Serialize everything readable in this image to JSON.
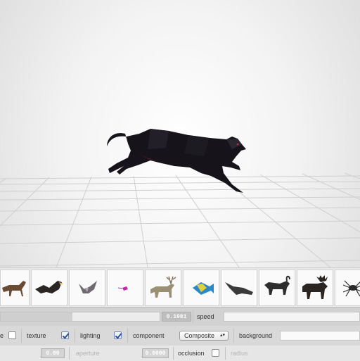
{
  "viewport": {
    "animal_name": "panther",
    "grid_color": "#cfcfcf",
    "model_color": "#16141a"
  },
  "thumbnails": [
    {
      "name": "horse",
      "icon": "horse-icon"
    },
    {
      "name": "eagle",
      "icon": "eagle-icon"
    },
    {
      "name": "owl",
      "icon": "owl-icon"
    },
    {
      "name": "hummingbird",
      "icon": "hummingbird-icon"
    },
    {
      "name": "stag",
      "icon": "stag-icon"
    },
    {
      "name": "fish",
      "icon": "fish-icon"
    },
    {
      "name": "crocodile",
      "icon": "crocodile-icon"
    },
    {
      "name": "goat",
      "icon": "goat-icon"
    },
    {
      "name": "moose",
      "icon": "moose-icon"
    },
    {
      "name": "spider",
      "icon": "spider-icon"
    }
  ],
  "controls": {
    "speed": {
      "value": "0.1981",
      "label": "speed",
      "fraction": 0.45
    },
    "row2": {
      "cut_label": "e",
      "wireframe_checked": false,
      "texture_label": "texture",
      "texture_checked": true,
      "lighting_label": "lighting",
      "lighting_checked": true,
      "component_label": "component",
      "component_value": "Composite",
      "background_label": "background"
    },
    "row3": {
      "aperture_label": "aperture",
      "aperture_value": "0.0000",
      "left_value": "0.00",
      "occlusion_label": "occlusion",
      "occlusion_checked": false,
      "radius_label": "radius"
    }
  },
  "colors": {
    "accent_check": "#2a4f9c",
    "panel_bg": "#d9d9d9",
    "value_box_bg": "#bfbfbf"
  }
}
